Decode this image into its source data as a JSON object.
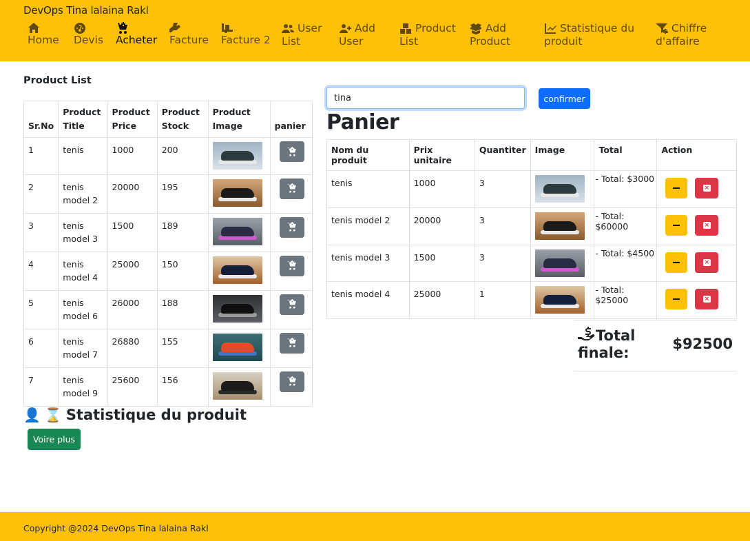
{
  "brand": "DevOps Tina lalaina Rakl",
  "nav": [
    {
      "id": "home",
      "line1": "Home",
      "line2": "",
      "icon": "home-icon"
    },
    {
      "id": "devis",
      "line1": "Devis",
      "line2": "",
      "icon": "gauge-icon"
    },
    {
      "id": "acheter",
      "line1": "Acheter",
      "line2": "",
      "icon": "cart-plus-icon"
    },
    {
      "id": "facture",
      "line1": "Facture",
      "line2": "",
      "icon": "hand-holding-icon"
    },
    {
      "id": "facture2",
      "line1": "Facture 2",
      "line2": "",
      "icon": "truck-ramp-icon"
    },
    {
      "id": "userlist",
      "line1": "User",
      "line2": "List",
      "icon": "users-icon"
    },
    {
      "id": "adduser",
      "line1": "Add",
      "line2": "User",
      "icon": "user-plus-icon"
    },
    {
      "id": "productlist",
      "line1": "Product",
      "line2": "List",
      "icon": "boxes-icon"
    },
    {
      "id": "addproduct",
      "line1": "Add",
      "line2": "Product",
      "icon": "box-open-icon"
    },
    {
      "id": "stat",
      "line1": "Statistique du",
      "line2": "produit",
      "icon": "chart-line-icon"
    },
    {
      "id": "ca",
      "line1": "Chiffre",
      "line2": "d'affaire",
      "icon": "filter-dollar-icon"
    }
  ],
  "product_list": {
    "title": "Product List",
    "headers": [
      "Sr.No",
      "Product Title",
      "Product Price",
      "Product Stock",
      "Product Image",
      "panier"
    ],
    "rows": [
      {
        "no": "1",
        "title": "tenis",
        "price": "1000",
        "stock": "200",
        "img": "s1"
      },
      {
        "no": "2",
        "title": "tenis model 2",
        "price": "20000",
        "stock": "195",
        "img": "s2"
      },
      {
        "no": "3",
        "title": "tenis model 3",
        "price": "1500",
        "stock": "189",
        "img": "s3"
      },
      {
        "no": "4",
        "title": "tenis model 4",
        "price": "25000",
        "stock": "150",
        "img": "s4"
      },
      {
        "no": "5",
        "title": "tenis model 6",
        "price": "26000",
        "stock": "188",
        "img": "s5"
      },
      {
        "no": "6",
        "title": "tenis model 7",
        "price": "26880",
        "stock": "155",
        "img": "s6"
      },
      {
        "no": "7",
        "title": "tenis model 9",
        "price": "25600",
        "stock": "156",
        "img": "s7"
      }
    ]
  },
  "stats": {
    "heading": "Statistique du produit",
    "button": "Voire plus"
  },
  "search": {
    "value": "tina"
  },
  "confirm_button": "confirmer",
  "cart": {
    "title": "Panier",
    "headers": [
      "Nom du produit",
      "Prix unitaire",
      "Quantiter",
      "Image",
      "Total",
      "Action"
    ],
    "rows": [
      {
        "name": "tenis",
        "price": "1000",
        "qty": "3",
        "img": "s1",
        "total": "- Total: $3000"
      },
      {
        "name": "tenis model 2",
        "price": "20000",
        "qty": "3",
        "img": "s2",
        "total": "- Total: $60000"
      },
      {
        "name": "tenis model 3",
        "price": "1500",
        "qty": "3",
        "img": "s3",
        "total": "- Total: $4500"
      },
      {
        "name": "tenis model 4",
        "price": "25000",
        "qty": "1",
        "img": "s4",
        "total": "- Total: $25000"
      }
    ],
    "final_label_1": "Total",
    "final_label_2": "finale:",
    "final_value": "$92500"
  },
  "footer": "Copyright @2024 DevOps Tina lalaina Rakl"
}
